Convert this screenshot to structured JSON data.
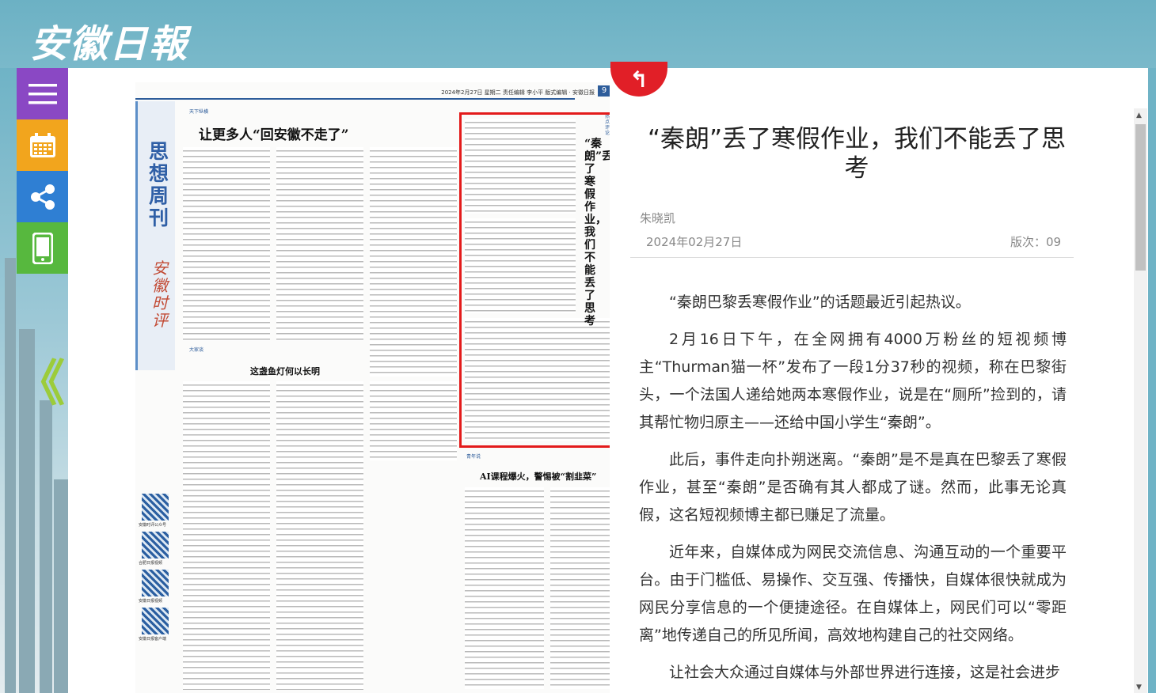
{
  "header": {
    "logo_text": "安徽日報"
  },
  "nav": {
    "items": [
      {
        "name": "menu",
        "icon": "hamburger-icon"
      },
      {
        "name": "calendar",
        "icon": "calendar-icon"
      },
      {
        "name": "share",
        "icon": "share-icon"
      },
      {
        "name": "mobile",
        "icon": "mobile-icon"
      }
    ],
    "prev_page": "《"
  },
  "newspaper": {
    "page_header": "2024年2月27日  星期二  责任编辑  李小平  版式编辑 · 安徽日报",
    "page_number": "9",
    "band_title": "思想周刊",
    "band_logo": "安徽时评",
    "headline_main": "让更多人“回安徽不走了”",
    "headline_2": "这盏鱼灯何以长明",
    "headline_3": "AI课程爆火，警惕被“割韭菜”",
    "vertical_title": "“秦朗”丢了寒假作业，我们不能丢了思考",
    "sec_tag_1": "天下纵横",
    "sec_tag_2": "热点评论",
    "sec_tag_3": "大家谈",
    "sec_tag_4": "青年说",
    "qr_captions": [
      "安徽时评公众号",
      "合肥日报视频",
      "安徽日报视频",
      "安徽日报客户端"
    ]
  },
  "article": {
    "title": "“秦朗”丢了寒假作业，我们不能丢了思考",
    "author": "朱晓凯",
    "date": "2024年02月27日",
    "edition": "版次：09",
    "paragraphs": [
      "“秦朗巴黎丢寒假作业”的话题最近引起热议。",
      "2月16日下午，在全网拥有4000万粉丝的短视频博主“Thurman猫一杯”发布了一段1分37秒的视频，称在巴黎街头，一个法国人递给她两本寒假作业，说是在“厕所”捡到的，请其帮忙物归原主——还给中国小学生“秦朗”。",
      "此后，事件走向扑朔迷离。“秦朗”是不是真在巴黎丢了寒假作业，甚至“秦朗”是否确有其人都成了谜。然而，此事无论真假，这名短视频博主都已赚足了流量。",
      "近年来，自媒体成为网民交流信息、沟通互动的一个重要平台。由于门槛低、易操作、交互强、传播快，自媒体很快就成为网民分享信息的一个便捷途径。在自媒体上，网民们可以“零距离”地传递自己的所见所闻，高效地构建自己的社交网络。",
      "让社会大众通过自媒体与外部世界进行连接，这是社会进步"
    ]
  },
  "colors": {
    "header_bg": "#6fb3c6",
    "highlight_border": "#e31b1b",
    "tab_red": "#e11f27"
  }
}
